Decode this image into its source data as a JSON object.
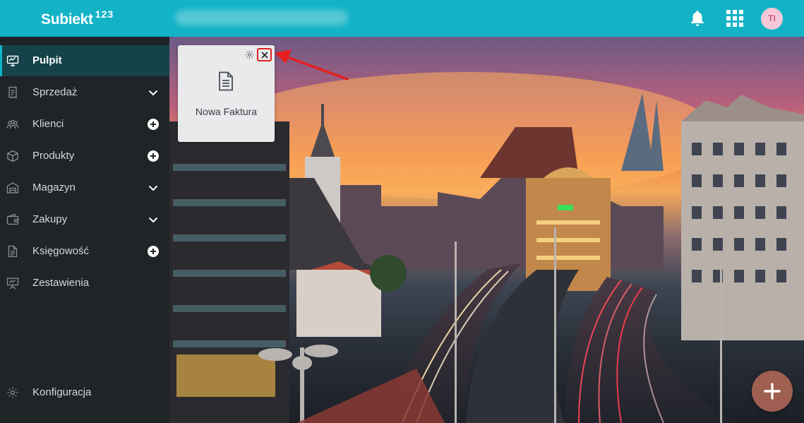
{
  "app": {
    "logo_text": "Subiekt",
    "logo_suffix": "123"
  },
  "header": {
    "user_initials": "TI",
    "bell_icon": "bell-icon",
    "apps_icon": "apps-grid-icon"
  },
  "sidebar": {
    "items": [
      {
        "label": "Pulpit",
        "icon": "desktop-icon",
        "active": true,
        "right": ""
      },
      {
        "label": "Sprzedaż",
        "icon": "receipt-icon",
        "right": "chevron-down-icon"
      },
      {
        "label": "Klienci",
        "icon": "users-icon",
        "right": "add-icon"
      },
      {
        "label": "Produkty",
        "icon": "box-icon",
        "right": "add-icon"
      },
      {
        "label": "Magazyn",
        "icon": "warehouse-icon",
        "right": "chevron-down-icon"
      },
      {
        "label": "Zakupy",
        "icon": "wallet-icon",
        "right": "chevron-down-icon"
      },
      {
        "label": "Księgowość",
        "icon": "document-icon",
        "right": "add-icon"
      },
      {
        "label": "Zestawienia",
        "icon": "presentation-icon",
        "right": ""
      }
    ],
    "config_label": "Konfiguracja"
  },
  "widget": {
    "label": "Nowa Faktura",
    "gear_icon": "gear-icon",
    "close_icon": "close-icon"
  },
  "colors": {
    "header": "#12b3c6",
    "sidebar": "#1f2426",
    "active_item": "#16424a",
    "highlight": "#e02020"
  }
}
